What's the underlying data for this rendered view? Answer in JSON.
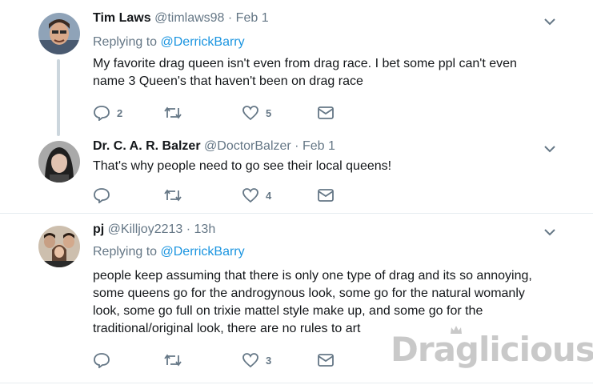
{
  "tweets": [
    {
      "name": "Tim Laws",
      "handle": "@timlaws98",
      "time": " · Feb 1",
      "replying_prefix": "Replying to ",
      "replying_to": "@DerrickBarry",
      "lines": [
        "My favorite drag queen isn't even from drag race. I bet some ppl can't even",
        "name 3 Queen's that haven't been on drag race"
      ],
      "replies": "2",
      "retweets": "",
      "likes": "5"
    },
    {
      "name": "Dr. C. A. R. Balzer",
      "handle": "@DoctorBalzer",
      "time": " · Feb 1",
      "lines": [
        "That's why people need to go see their local queens!"
      ],
      "replies": "",
      "retweets": "",
      "likes": "4"
    },
    {
      "name": "pj",
      "handle": "@Killjoy2213",
      "time": " · 13h",
      "replying_prefix": "Replying to ",
      "replying_to": "@DerrickBarry",
      "lines": [
        "people keep assuming that there is only one type of drag and its so annoying,",
        "some queens go for the androgynous look, some go for the natural womanly",
        "look, some go full on trixie mattel style make up, and some go for the",
        "traditional/original look, there are no rules to art"
      ],
      "replies": "",
      "retweets": "",
      "likes": "3"
    }
  ],
  "watermark": "Draglicious",
  "colors": {
    "link": "#1b95e0",
    "muted": "#657786",
    "divider": "#e6ecf0",
    "thread_line": "#ccd6dd"
  }
}
